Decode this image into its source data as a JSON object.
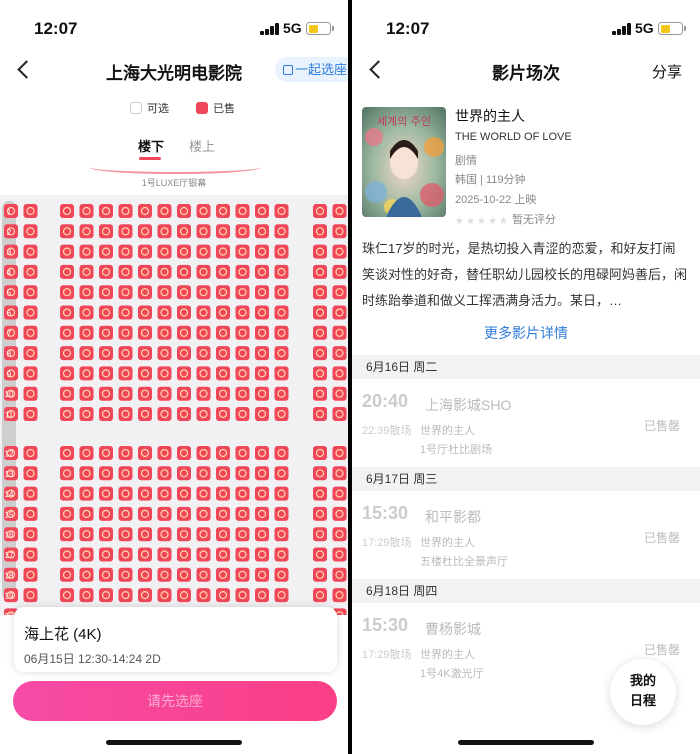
{
  "left": {
    "status": {
      "time": "12:07",
      "network": "5G"
    },
    "title": "上海大光明电影院",
    "invite_label": "一起选座",
    "legend": {
      "available": "可选",
      "sold": "已售"
    },
    "floors": [
      "楼下",
      "楼上"
    ],
    "screen_label": "1号LUXE厅银幕",
    "seat_map": {
      "section1_rows": [
        "1",
        "2",
        "3",
        "4",
        "5",
        "6",
        "7",
        "8",
        "9",
        "10",
        "11"
      ],
      "section2_rows": [
        "12",
        "13",
        "14",
        "15",
        "16",
        "17",
        "18",
        "19",
        "20"
      ],
      "blocks_per_row": [
        2,
        12,
        2
      ],
      "status": "all-sold",
      "sold_color": "#f0465a"
    },
    "movie": {
      "title": "海上花 (4K)",
      "showtime": "06月15日 12:30-14:24 2D"
    },
    "cta_label": "请先选座"
  },
  "right": {
    "status": {
      "time": "12:07",
      "network": "5G"
    },
    "title": "影片场次",
    "share_label": "分享",
    "movie": {
      "title": "世界的主人",
      "english_title": "THE WORLD OF LOVE",
      "genre": "剧情",
      "country_runtime": "韩国 | 119分钟",
      "release": "2025-10-22 上映",
      "rating": "暂无评分",
      "poster_text": "세계의 주인",
      "synopsis": "珠仁17岁的时光，是热切投入青涩的恋爱，和好友打闹笑谈对性的好奇，替任职幼儿园校长的甩碌阿妈善后，闲时练跆拳道和做义工挥洒满身活力。某日，…",
      "more_label": "更多影片详情"
    },
    "schedule": [
      {
        "date": "6月16日 周二",
        "start": "20:40",
        "end": "22:39散场",
        "cinema": "上海影城SHO",
        "movie": "世界的主人",
        "hall": "1号厅杜比剧场",
        "status": "已售罄"
      },
      {
        "date": "6月17日 周三",
        "start": "15:30",
        "end": "17:29散场",
        "cinema": "和平影都",
        "movie": "世界的主人",
        "hall": "五楼杜比全景声厅",
        "status": "已售罄"
      },
      {
        "date": "6月18日 周四",
        "start": "15:30",
        "end": "17:29散场",
        "cinema": "曹杨影城",
        "movie": "世界的主人",
        "hall": "1号4K激光厅",
        "status": "已售罄"
      }
    ],
    "schedule_button": {
      "line1": "我的",
      "line2": "日程"
    }
  }
}
